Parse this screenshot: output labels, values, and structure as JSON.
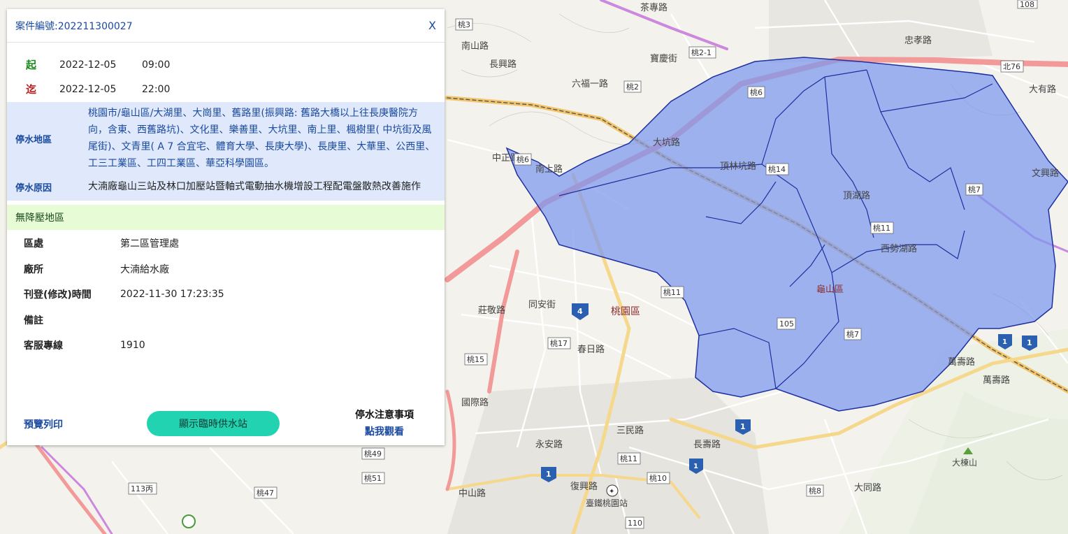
{
  "popup": {
    "case_label": "案件編號:202211300027",
    "close_label": "X",
    "start_tag": "起",
    "start_date": "2022-12-05",
    "start_time": "09:00",
    "end_tag": "迄",
    "end_date": "2022-12-05",
    "end_time": "22:00",
    "area_label": "停水地區",
    "area_value": "桃園市/龜山區/大湖里、大崗里、舊路里(振興路: 舊路大橋以上往長庚醫院方向，含東、西舊路坑)、文化里、樂善里、大坑里、南上里、楓樹里( 中坑街及風尾街)、文青里( A 7 合宜宅、體育大學、長庚大學)、長庚里、大華里、公西里、工三工業區、工四工業區、華亞科學園區。",
    "reason_label": "停水原因",
    "reason_value": "大湳廠龜山三站及林口加壓站暨軸式電動抽水機增設工程配電盤散熱改善施作",
    "no_pressure_label": "無降壓地區",
    "details": [
      {
        "label": "區處",
        "value": "第二區管理處"
      },
      {
        "label": "廠所",
        "value": "大湳給水廠"
      },
      {
        "label": "刊登(修改)時間",
        "value": "2022-11-30 17:23:35"
      },
      {
        "label": "備註",
        "value": ""
      },
      {
        "label": "客服專線",
        "value": "1910"
      }
    ],
    "print_label": "預覽列印",
    "station_button_label": "顯示臨時供水站",
    "notice_title": "停水注意事項",
    "notice_link": "點我觀看"
  },
  "map": {
    "labels": [
      "龜山區",
      "桃園區",
      "大棟山",
      "臺鐵桃園站",
      "六福一路",
      "南上路",
      "大坑路",
      "頂湖路",
      "西勢湖路",
      "萬壽路",
      "長壽路",
      "復興路",
      "中山路",
      "三民路",
      "永安路",
      "大同路",
      "忠孝路",
      "文興路",
      "南山路",
      "長興路",
      "中正路",
      "莊敬路",
      "同安街",
      "春日路",
      "龍壽街",
      "茶專路",
      "頂林坑路",
      "寶慶街",
      "國際路",
      "大有路",
      "萬壽路"
    ],
    "route_numbers": [
      "桃3",
      "桃2-1",
      "桃2",
      "桃6",
      "桃14",
      "桃11",
      "桃7",
      "105",
      "桃17",
      "桃15",
      "桃49",
      "桃51",
      "桃10",
      "桃8",
      "113丙",
      "桃47",
      "110",
      "北76",
      "108",
      "桃6"
    ],
    "highway_badges": [
      "4",
      "1",
      "1",
      "1",
      "1"
    ],
    "colors": {
      "polygon_fill": "#7b97ee",
      "polygon_stroke": "#1e2fa0",
      "panel_blue": "#dfe9fb",
      "green_bar": "#e6fbd6",
      "button": "#22d3b2",
      "link": "#1a4aa0"
    }
  }
}
